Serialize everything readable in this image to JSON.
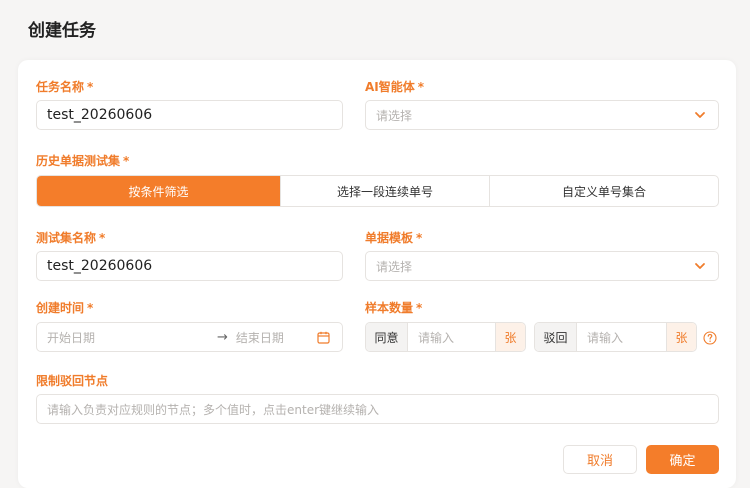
{
  "page": {
    "title": "创建任务"
  },
  "form": {
    "task_name": {
      "label": "任务名称",
      "value": "test_20260606"
    },
    "ai_agent": {
      "label": "AI智能体",
      "placeholder": "请选择"
    },
    "history_set": {
      "label": "历史单据测试集",
      "options": [
        "按条件筛选",
        "选择一段连续单号",
        "自定义单号集合"
      ],
      "selected": "按条件筛选"
    },
    "testset_name": {
      "label": "测试集名称",
      "value": "test_20260606"
    },
    "doc_template": {
      "label": "单据模板",
      "placeholder": "请选择"
    },
    "create_time": {
      "label": "创建时间",
      "start_placeholder": "开始日期",
      "arrow": "→",
      "end_placeholder": "结束日期"
    },
    "sample_count": {
      "label": "样本数量",
      "approve": {
        "prefix": "同意",
        "placeholder": "请输入",
        "suffix": "张"
      },
      "reject": {
        "prefix": "驳回",
        "placeholder": "请输入",
        "suffix": "张"
      }
    },
    "limit_reject_nodes": {
      "label": "限制驳回节点",
      "placeholder": "请输入负责对应规则的节点；多个值时，点击enter键继续输入"
    },
    "required_mark": "*"
  },
  "actions": {
    "cancel": "取消",
    "confirm": "确定"
  },
  "colors": {
    "accent": "#f47d2a",
    "label": "#f07c2b"
  },
  "icons": {
    "select": "chevron-down-icon",
    "date": "calendar-icon",
    "help": "question-circle-icon"
  }
}
